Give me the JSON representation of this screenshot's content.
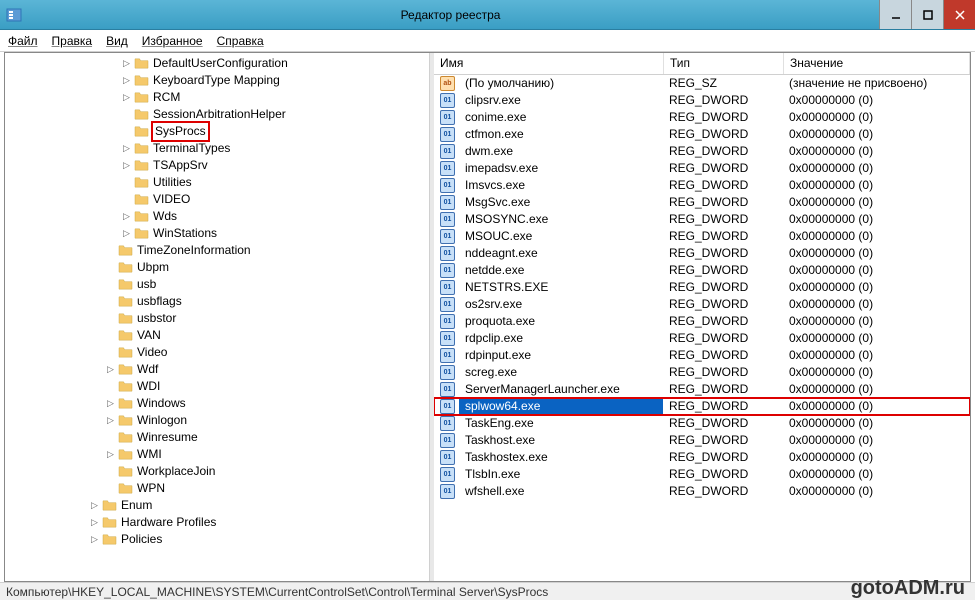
{
  "window": {
    "title": "Редактор реестра",
    "status_path": "Компьютер\\HKEY_LOCAL_MACHINE\\SYSTEM\\CurrentControlSet\\Control\\Terminal Server\\SysProcs"
  },
  "menu": {
    "file": "Файл",
    "edit": "Правка",
    "view": "Вид",
    "favorites": "Избранное",
    "help": "Справка"
  },
  "tree": {
    "items": [
      {
        "indent": 7,
        "exp": "▷",
        "label": "DefaultUserConfiguration"
      },
      {
        "indent": 7,
        "exp": "▷",
        "label": "KeyboardType Mapping"
      },
      {
        "indent": 7,
        "exp": "▷",
        "label": "RCM"
      },
      {
        "indent": 7,
        "exp": "",
        "label": "SessionArbitrationHelper"
      },
      {
        "indent": 7,
        "exp": "",
        "label": "SysProcs",
        "highlight": true
      },
      {
        "indent": 7,
        "exp": "▷",
        "label": "TerminalTypes"
      },
      {
        "indent": 7,
        "exp": "▷",
        "label": "TSAppSrv"
      },
      {
        "indent": 7,
        "exp": "",
        "label": "Utilities"
      },
      {
        "indent": 7,
        "exp": "",
        "label": "VIDEO"
      },
      {
        "indent": 7,
        "exp": "▷",
        "label": "Wds"
      },
      {
        "indent": 7,
        "exp": "▷",
        "label": "WinStations"
      },
      {
        "indent": 6,
        "exp": "",
        "label": "TimeZoneInformation"
      },
      {
        "indent": 6,
        "exp": "",
        "label": "Ubpm"
      },
      {
        "indent": 6,
        "exp": "",
        "label": "usb"
      },
      {
        "indent": 6,
        "exp": "",
        "label": "usbflags"
      },
      {
        "indent": 6,
        "exp": "",
        "label": "usbstor"
      },
      {
        "indent": 6,
        "exp": "",
        "label": "VAN"
      },
      {
        "indent": 6,
        "exp": "",
        "label": "Video"
      },
      {
        "indent": 6,
        "exp": "▷",
        "label": "Wdf"
      },
      {
        "indent": 6,
        "exp": "",
        "label": "WDI"
      },
      {
        "indent": 6,
        "exp": "▷",
        "label": "Windows"
      },
      {
        "indent": 6,
        "exp": "▷",
        "label": "Winlogon"
      },
      {
        "indent": 6,
        "exp": "",
        "label": "Winresume"
      },
      {
        "indent": 6,
        "exp": "▷",
        "label": "WMI"
      },
      {
        "indent": 6,
        "exp": "",
        "label": "WorkplaceJoin"
      },
      {
        "indent": 6,
        "exp": "",
        "label": "WPN"
      },
      {
        "indent": 5,
        "exp": "▷",
        "label": "Enum"
      },
      {
        "indent": 5,
        "exp": "▷",
        "label": "Hardware Profiles"
      },
      {
        "indent": 5,
        "exp": "▷",
        "label": "Policies"
      }
    ]
  },
  "list": {
    "headers": {
      "name": "Имя",
      "type": "Тип",
      "value": "Значение"
    },
    "rows": [
      {
        "icon": "string",
        "name": "(По умолчанию)",
        "type": "REG_SZ",
        "value": "(значение не присвоено)"
      },
      {
        "icon": "dword",
        "name": "clipsrv.exe",
        "type": "REG_DWORD",
        "value": "0x00000000 (0)"
      },
      {
        "icon": "dword",
        "name": "conime.exe",
        "type": "REG_DWORD",
        "value": "0x00000000 (0)"
      },
      {
        "icon": "dword",
        "name": "ctfmon.exe",
        "type": "REG_DWORD",
        "value": "0x00000000 (0)"
      },
      {
        "icon": "dword",
        "name": "dwm.exe",
        "type": "REG_DWORD",
        "value": "0x00000000 (0)"
      },
      {
        "icon": "dword",
        "name": "imepadsv.exe",
        "type": "REG_DWORD",
        "value": "0x00000000 (0)"
      },
      {
        "icon": "dword",
        "name": "Imsvcs.exe",
        "type": "REG_DWORD",
        "value": "0x00000000 (0)"
      },
      {
        "icon": "dword",
        "name": "MsgSvc.exe",
        "type": "REG_DWORD",
        "value": "0x00000000 (0)"
      },
      {
        "icon": "dword",
        "name": "MSOSYNC.exe",
        "type": "REG_DWORD",
        "value": "0x00000000 (0)"
      },
      {
        "icon": "dword",
        "name": "MSOUC.exe",
        "type": "REG_DWORD",
        "value": "0x00000000 (0)"
      },
      {
        "icon": "dword",
        "name": "nddeagnt.exe",
        "type": "REG_DWORD",
        "value": "0x00000000 (0)"
      },
      {
        "icon": "dword",
        "name": "netdde.exe",
        "type": "REG_DWORD",
        "value": "0x00000000 (0)"
      },
      {
        "icon": "dword",
        "name": "NETSTRS.EXE",
        "type": "REG_DWORD",
        "value": "0x00000000 (0)"
      },
      {
        "icon": "dword",
        "name": "os2srv.exe",
        "type": "REG_DWORD",
        "value": "0x00000000 (0)"
      },
      {
        "icon": "dword",
        "name": "proquota.exe",
        "type": "REG_DWORD",
        "value": "0x00000000 (0)"
      },
      {
        "icon": "dword",
        "name": "rdpclip.exe",
        "type": "REG_DWORD",
        "value": "0x00000000 (0)"
      },
      {
        "icon": "dword",
        "name": "rdpinput.exe",
        "type": "REG_DWORD",
        "value": "0x00000000 (0)"
      },
      {
        "icon": "dword",
        "name": "screg.exe",
        "type": "REG_DWORD",
        "value": "0x00000000 (0)"
      },
      {
        "icon": "dword",
        "name": "ServerManagerLauncher.exe",
        "type": "REG_DWORD",
        "value": "0x00000000 (0)"
      },
      {
        "icon": "dword",
        "name": "splwow64.exe",
        "type": "REG_DWORD",
        "value": "0x00000000 (0)",
        "selected": true
      },
      {
        "icon": "dword",
        "name": "TaskEng.exe",
        "type": "REG_DWORD",
        "value": "0x00000000 (0)"
      },
      {
        "icon": "dword",
        "name": "Taskhost.exe",
        "type": "REG_DWORD",
        "value": "0x00000000 (0)"
      },
      {
        "icon": "dword",
        "name": "Taskhostex.exe",
        "type": "REG_DWORD",
        "value": "0x00000000 (0)"
      },
      {
        "icon": "dword",
        "name": "TlsbIn.exe",
        "type": "REG_DWORD",
        "value": "0x00000000 (0)"
      },
      {
        "icon": "dword",
        "name": "wfshell.exe",
        "type": "REG_DWORD",
        "value": "0x00000000 (0)"
      }
    ]
  },
  "watermark": "gotoADM.ru"
}
